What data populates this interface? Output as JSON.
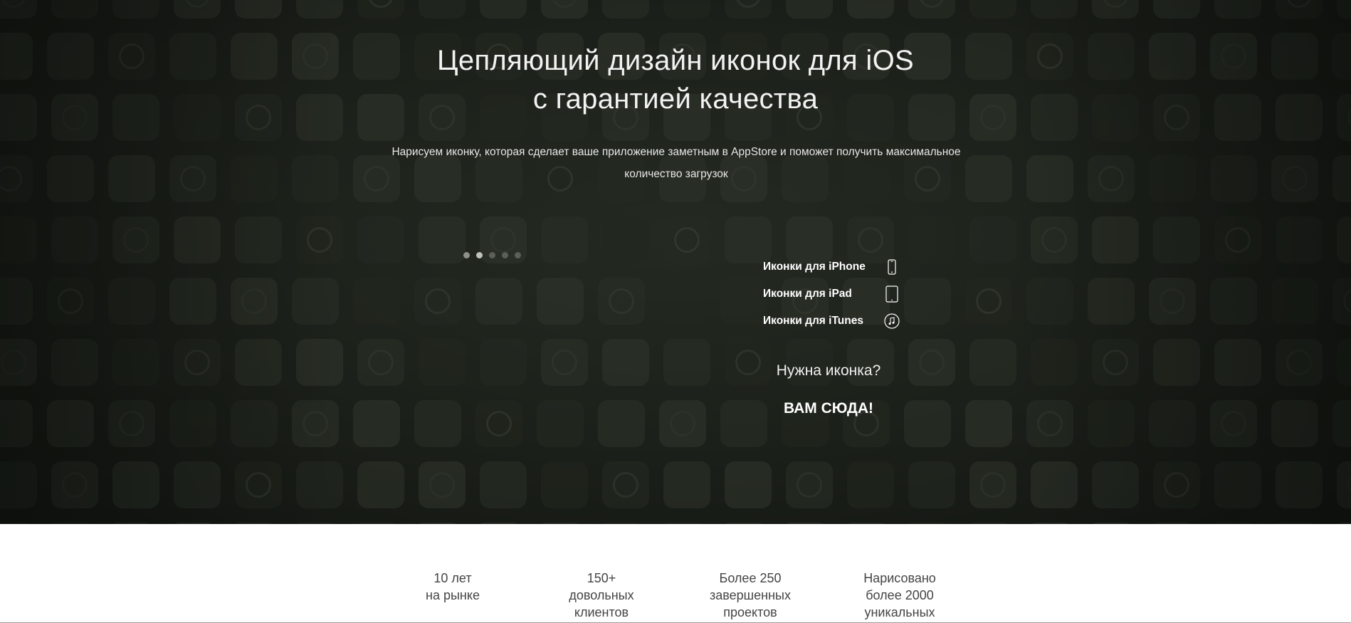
{
  "hero": {
    "title_line1": "Цепляющий дизайн иконок для iOS",
    "title_line2": "с гарантией качества",
    "subtitle": "Нарисуем иконку, которая сделает ваше приложение заметным в AppStore и поможет получить максимальное количество загрузок",
    "slider": {
      "count": 5,
      "active_index": 1
    },
    "links": [
      {
        "label": "Иконки для iPhone",
        "icon": "iphone-icon"
      },
      {
        "label": "Иконки для iPad",
        "icon": "ipad-icon"
      },
      {
        "label": "Иконки для iTunes",
        "icon": "itunes-icon"
      }
    ],
    "cta_question": "Нужна иконка?",
    "cta_button": "ВАМ СЮДА!"
  },
  "stats": [
    {
      "line1": "10 лет",
      "line2": "на рынке",
      "line3": ""
    },
    {
      "line1": "150+",
      "line2": "довольных",
      "line3": "клиентов"
    },
    {
      "line1": "Более 250",
      "line2": "завершенных",
      "line3": "проектов"
    },
    {
      "line1": "Нарисовано",
      "line2": "более 2000",
      "line3": "уникальных"
    }
  ],
  "colors": {
    "hero_bg": "#1b1f19",
    "text_light": "#ffffff",
    "stats_text": "#444444"
  }
}
